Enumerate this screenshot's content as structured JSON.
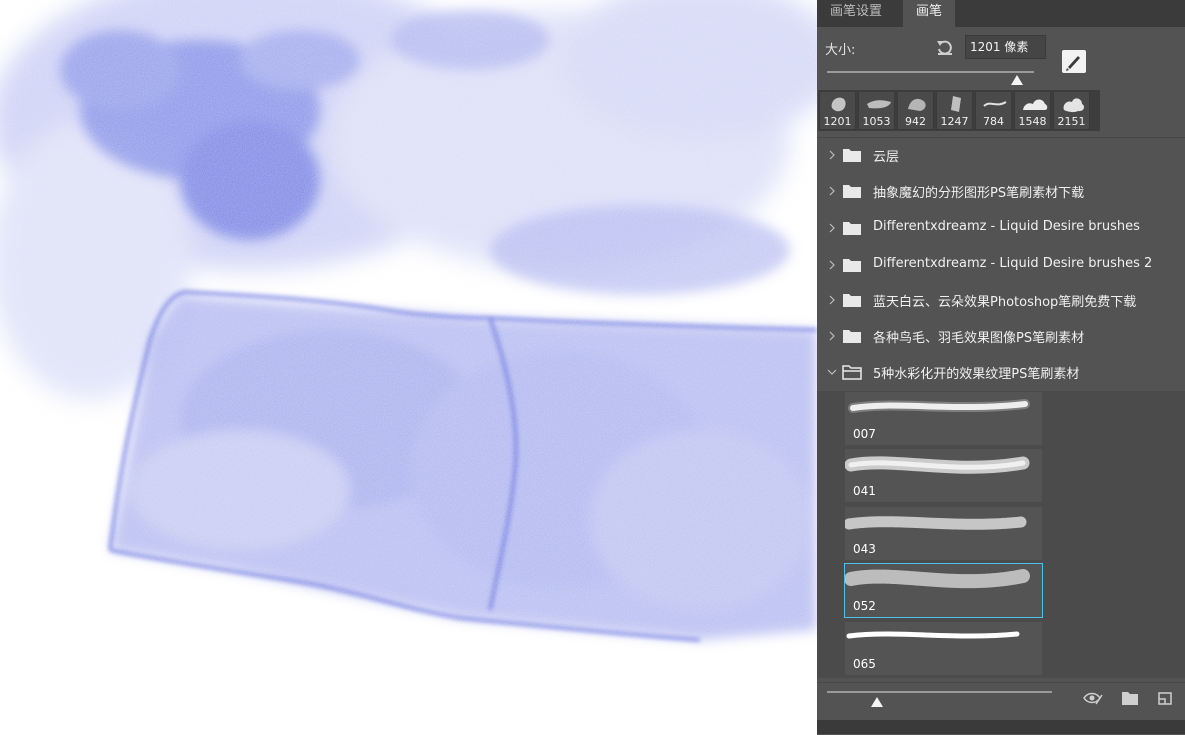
{
  "tabs": [
    {
      "label": "画笔设置",
      "active": false
    },
    {
      "label": "画笔",
      "active": true
    }
  ],
  "size": {
    "label": "大小:",
    "value": "1201 像素",
    "slider_fraction": 0.92
  },
  "recent_brushes": [
    "1201",
    "1053",
    "942",
    "1247",
    "784",
    "1548",
    "2151"
  ],
  "groups": [
    {
      "label": "云层",
      "expanded": false
    },
    {
      "label": "抽象魔幻的分形图形PS笔刷素材下载",
      "expanded": false
    },
    {
      "label": "Differentxdreamz - Liquid Desire brushes",
      "expanded": false
    },
    {
      "label": "Differentxdreamz - Liquid Desire brushes 2",
      "expanded": false
    },
    {
      "label": "蓝天白云、云朵效果Photoshop笔刷免费下载",
      "expanded": false
    },
    {
      "label": "各种鸟毛、羽毛效果图像PS笔刷素材",
      "expanded": false
    },
    {
      "label": "5种水彩化开的效果纹理PS笔刷素材",
      "expanded": true
    }
  ],
  "brushes": [
    {
      "name": "007",
      "selected": false
    },
    {
      "name": "041",
      "selected": false
    },
    {
      "name": "043",
      "selected": false
    },
    {
      "name": "052",
      "selected": true
    },
    {
      "name": "065",
      "selected": false
    }
  ],
  "preview_size_fraction": 0.22,
  "colors": {
    "panel_bg": "#535353",
    "tab_bar": "#3b3b3b",
    "selection_border": "#4fc1e9",
    "watercolor": "#6f7be3"
  },
  "icons": {
    "reset": "reset-icon",
    "new_brush": "new-brush-icon",
    "chevron_right": "chevron-right-icon",
    "chevron_down": "chevron-down-icon",
    "folder": "folder-icon",
    "folder_open": "folder-open-icon",
    "visibility": "eye-icon",
    "new_group": "new-group-icon",
    "new_preset": "new-preset-icon"
  }
}
